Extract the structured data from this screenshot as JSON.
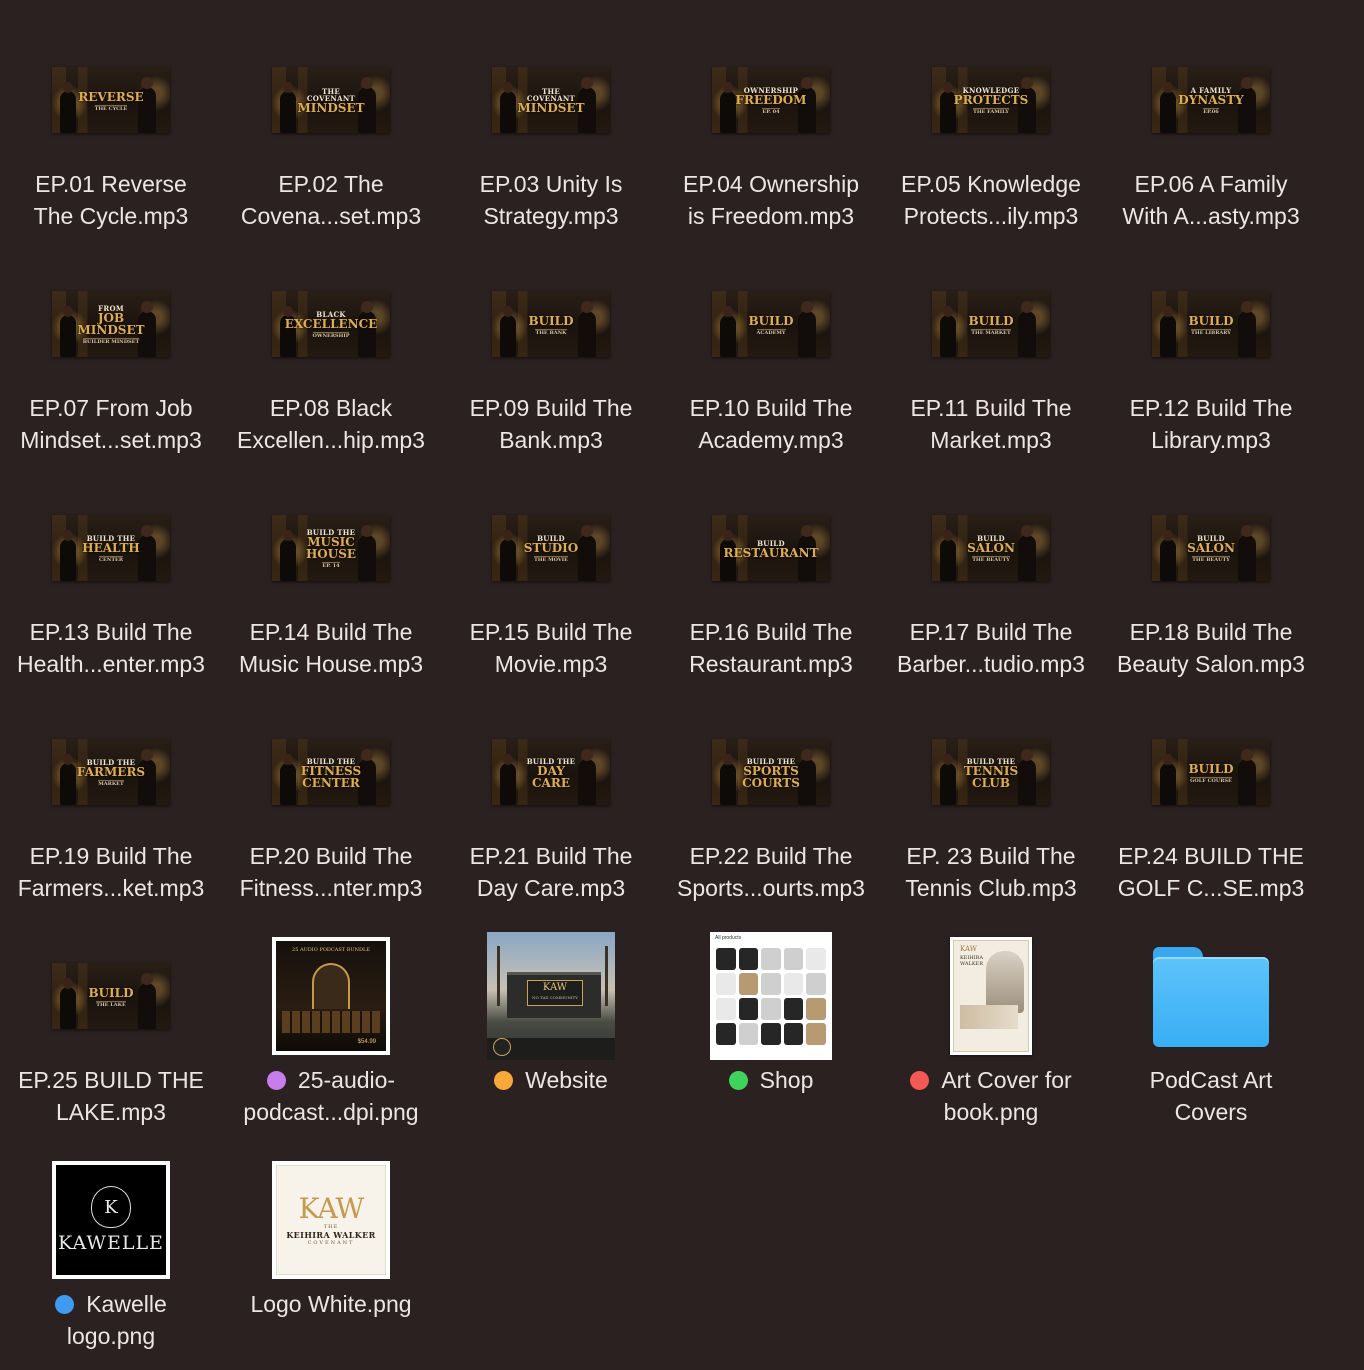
{
  "tag_colors": {
    "purple": "#c77dec",
    "orange": "#f6a93a",
    "green": "#3fd35d",
    "red": "#f35a55",
    "blue": "#3f9bf1"
  },
  "files": [
    {
      "line1": "EP.01 Reverse",
      "line2": "The Cycle.mp3",
      "thumb": {
        "t1": "",
        "t2": "REVERSE",
        "t3": "THE CYCLE"
      }
    },
    {
      "line1": "EP.02 The",
      "line2": "Covena...set.mp3",
      "thumb": {
        "t1": "THE COVENANT",
        "t2": "MINDSET",
        "t3": ""
      }
    },
    {
      "line1": "EP.03 Unity Is",
      "line2": "Strategy.mp3",
      "thumb": {
        "t1": "THE COVENANT",
        "t2": "MINDSET",
        "t3": ""
      }
    },
    {
      "line1": "EP.04 Ownership",
      "line2": "is Freedom.mp3",
      "thumb": {
        "t1": "OWNERSHIP",
        "t2": "FREEDOM",
        "t3": "EP. 04"
      }
    },
    {
      "line1": "EP.05 Knowledge",
      "line2": "Protects...ily.mp3",
      "thumb": {
        "t1": "KNOWLEDGE",
        "t2": "PROTECTS",
        "t3": "THE FAMILY"
      }
    },
    {
      "line1": "EP.06 A Family",
      "line2": "With A...asty.mp3",
      "thumb": {
        "t1": "A FAMILY",
        "t2": "DYNASTY",
        "t3": "EP.06"
      }
    },
    {
      "line1": "EP.07 From Job",
      "line2": "Mindset...set.mp3",
      "thumb": {
        "t1": "FROM",
        "t2": "JOB MINDSET",
        "t3": "BUILDER MINDSET"
      }
    },
    {
      "line1": "EP.08 Black",
      "line2": "Excellen...hip.mp3",
      "thumb": {
        "t1": "BLACK",
        "t2": "EXCELLENCE",
        "t3": "OWNERSHIP"
      }
    },
    {
      "line1": "EP.09 Build The",
      "line2": "Bank.mp3",
      "thumb": {
        "t1": "",
        "t2": "BUILD",
        "t3": "THE BANK"
      }
    },
    {
      "line1": "EP.10 Build The",
      "line2": "Academy.mp3",
      "thumb": {
        "t1": "",
        "t2": "BUILD",
        "t3": "ACADEMY"
      }
    },
    {
      "line1": "EP.11 Build The",
      "line2": "Market.mp3",
      "thumb": {
        "t1": "",
        "t2": "BUILD",
        "t3": "THE MARKET"
      }
    },
    {
      "line1": "EP.12 Build The",
      "line2": "Library.mp3",
      "thumb": {
        "t1": "",
        "t2": "BUILD",
        "t3": "THE LIBRARY"
      }
    },
    {
      "line1": "EP.13 Build The",
      "line2": "Health...enter.mp3",
      "thumb": {
        "t1": "BUILD THE",
        "t2": "HEALTH",
        "t3": "CENTER"
      }
    },
    {
      "line1": "EP.14 Build The",
      "line2": "Music House.mp3",
      "thumb": {
        "t1": "BUILD THE",
        "t2": "MUSIC HOUSE",
        "t3": "EP. 14"
      }
    },
    {
      "line1": "EP.15 Build The",
      "line2": "Movie.mp3",
      "thumb": {
        "t1": "BUILD",
        "t2": "STUDIO",
        "t3": "THE MOVIE"
      }
    },
    {
      "line1": "EP.16 Build The",
      "line2": "Restaurant.mp3",
      "thumb": {
        "t1": "BUILD",
        "t2": "RESTAURANT",
        "t3": ""
      }
    },
    {
      "line1": "EP.17 Build The",
      "line2": "Barber...tudio.mp3",
      "thumb": {
        "t1": "BUILD",
        "t2": "SALON",
        "t3": "THE BEAUTY"
      }
    },
    {
      "line1": "EP.18 Build The",
      "line2": "Beauty Salon.mp3",
      "thumb": {
        "t1": "BUILD",
        "t2": "SALON",
        "t3": "THE BEAUTY"
      }
    },
    {
      "line1": "EP.19 Build The",
      "line2": "Farmers...ket.mp3",
      "thumb": {
        "t1": "BUILD THE",
        "t2": "FARMERS",
        "t3": "MARKET"
      }
    },
    {
      "line1": "EP.20 Build The",
      "line2": "Fitness...nter.mp3",
      "thumb": {
        "t1": "BUILD THE",
        "t2": "FITNESS CENTER",
        "t3": ""
      }
    },
    {
      "line1": "EP.21 Build The",
      "line2": "Day Care.mp3",
      "thumb": {
        "t1": "BUILD THE",
        "t2": "DAY CARE",
        "t3": ""
      }
    },
    {
      "line1": "EP.22 Build The",
      "line2": "Sports...ourts.mp3",
      "thumb": {
        "t1": "BUILD THE",
        "t2": "SPORTS COURTS",
        "t3": ""
      }
    },
    {
      "line1": "EP. 23 Build The",
      "line2": "Tennis Club.mp3",
      "thumb": {
        "t1": "BUILD THE",
        "t2": "TENNIS CLUB",
        "t3": ""
      }
    },
    {
      "line1": "EP.24 BUILD THE",
      "line2": "GOLF C...SE.mp3",
      "thumb": {
        "t1": "",
        "t2": "BUILD",
        "t3": "GOLF COURSE"
      }
    },
    {
      "line1": "EP.25 BUILD THE",
      "line2": "LAKE.mp3",
      "thumb": {
        "t1": "",
        "t2": "BUILD",
        "t3": "THE LAKE"
      }
    }
  ],
  "images": {
    "bundle": {
      "line1": "25-audio-",
      "line2": "podcast...dpi.png",
      "tag": "purple",
      "thumb_title": "25 AUDIO PODCAST BUNDLE",
      "thumb_price": "$54.99"
    },
    "website": {
      "label": "Website",
      "tag": "orange",
      "sign_main": "KAW",
      "sign_sub": "NO TAX COMMUNITY"
    },
    "shop": {
      "label": "Shop",
      "tag": "green",
      "header": "All products"
    },
    "book": {
      "line1": "Art Cover for",
      "line2": "book.png",
      "tag": "red",
      "mark": "KAW",
      "name1": "KEIHIRA",
      "name2": "WALKER"
    },
    "folder": {
      "line1": "PodCast Art",
      "line2": "Covers"
    },
    "kawelle": {
      "line1": "Kawelle",
      "line2": "logo.png",
      "tag": "blue",
      "crest": "K",
      "wordmark": "KAWELLE"
    },
    "logo_white": {
      "label": "Logo White.png",
      "mark": "KAW",
      "the": "THE",
      "name": "KEIHIRA WALKER",
      "sub": "COVENANT"
    }
  }
}
